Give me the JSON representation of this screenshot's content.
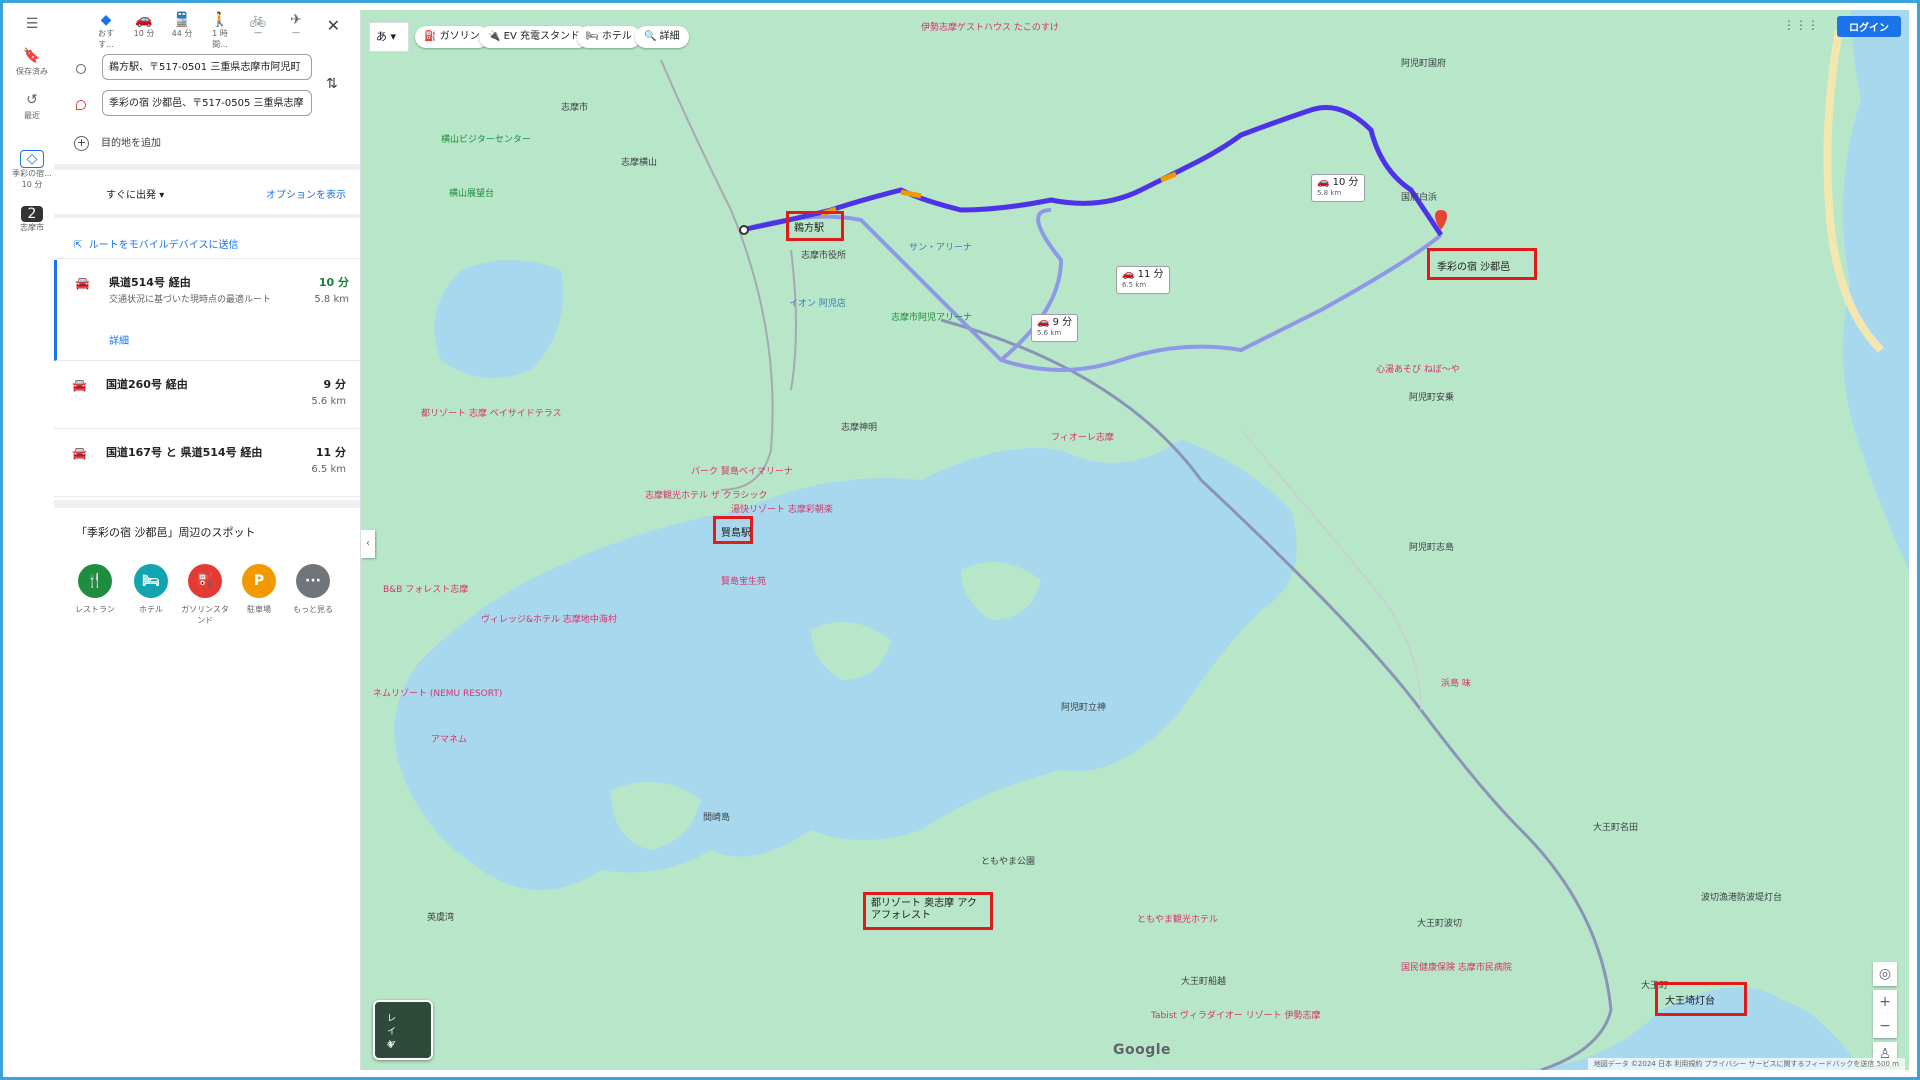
{
  "rail": {
    "saved": "保存済み",
    "recent": "最近",
    "item1": "季彩の宿...",
    "item1_sub": "10 分",
    "item2": "志摩市"
  },
  "modes": [
    {
      "label": "おすす...",
      "icon": "directions-icon"
    },
    {
      "label": "10 分",
      "icon": "car-icon"
    },
    {
      "label": "44 分",
      "icon": "transit-icon"
    },
    {
      "label": "1 時間...",
      "icon": "walk-icon"
    },
    {
      "label": "—",
      "icon": "bicycle-icon"
    },
    {
      "label": "—",
      "icon": "flight-icon"
    }
  ],
  "origin": "鵜方駅、〒517-0501 三重県志摩市阿児町",
  "destination": "季彩の宿 沙都邑、〒517-0505 三重県志摩",
  "add_destination": "目的地を追加",
  "depart": "すぐに出発",
  "options": "オプションを表示",
  "send_to_device": "ルートをモバイルデバイスに送信",
  "routes": [
    {
      "name": "県道514号 経由",
      "time": "10 分",
      "distance": "5.8 km",
      "desc": "交通状況に基づいた現時点の最適ルート",
      "details": "詳細"
    },
    {
      "name": "国道260号 経由",
      "time": "9 分",
      "distance": "5.6 km"
    },
    {
      "name": "国道167号 と 県道514号 経由",
      "time": "11 分",
      "distance": "6.5 km"
    }
  ],
  "nearby_title": "「季彩の宿 沙都邑」周辺のスポット",
  "categories": [
    {
      "label": "レストラン",
      "color": "#1e8e3e",
      "glyph": "🍴"
    },
    {
      "label": "ホテル",
      "color": "#12a4af",
      "glyph": "🛏"
    },
    {
      "label": "ガソリンスタンド",
      "color": "#e53935",
      "glyph": "⛽"
    },
    {
      "label": "駐車場",
      "color": "#f29900",
      "glyph": "P"
    },
    {
      "label": "もっと見る",
      "color": "#70757a",
      "glyph": "···"
    }
  ],
  "map": {
    "ime": "あ",
    "chips": [
      "ガソリン",
      "EV 充電スタンド",
      "ホテル",
      "詳細"
    ],
    "login": "ログイン",
    "layers": "レイヤ",
    "google": "Google",
    "footer": "地図データ ©2024   日本   利用規約   プライバシー   サービスに関するフィードバックを送信   500 m",
    "route_tags": [
      {
        "time": "10 分",
        "dist": "5.8 km"
      },
      {
        "time": "11 分",
        "dist": "6.5 km"
      },
      {
        "time": "9 分",
        "dist": "5.6 km"
      }
    ],
    "highlights": {
      "ugata": "鵜方駅",
      "kashikojima": "賢島駅",
      "satoyu": "季彩の宿 沙都邑",
      "miyako": "都リゾート 奥志摩 アクアフォレスト",
      "daiozaki": "大王埼灯台"
    },
    "labels": {
      "shima_city": "志摩市",
      "yokoyama_vc": "横山ビジターセンター",
      "yokoyama_obs": "横山展望台",
      "shima_yokoyama": "志摩横山",
      "shima_office": "志摩市役所",
      "aeon": "イオン 阿児店",
      "arena": "志摩市阿児アリーナ",
      "sun_arena": "サン・アリーナ",
      "ago_kokufu": "阿児町国府",
      "kokufu_beach": "国府白浜",
      "ago_anori": "阿児町安乗",
      "shinmei": "志摩神明",
      "ago_kou": "阿児町甲賀",
      "ago_shima": "阿児町志島",
      "ise_gh": "伊勢志摩ゲストハウス たこのすけ",
      "ago_nishi": "阿児町鵜方",
      "miyako_bayside": "都リゾート 志摩 ベイサイドテラス",
      "park_bay": "パーク 賢島ベイマリーナ",
      "shima_kanko": "志摩観光ホテル ザ クラシック",
      "yubo": "湯快リゾート 志摩彩朝楽",
      "kashiko_hoseien": "賢島宝生苑",
      "bb_forest": "B&B フォレスト志摩",
      "village": "ヴィレッジ&ホテル 志摩地中海村",
      "nemu": "ネムリゾート (NEMU RESORT)",
      "amanemu": "アマネム",
      "fiore": "フィオーレ志摩",
      "shinko_kou": "心湯あそび ねぼ〜や",
      "ago_anori2": "阿児町甲賀",
      "hamakaze": "浜島 味",
      "ago_hamajima": "阿児町立神",
      "ozaki": "間崎島",
      "eiheiwan": "英虞湾",
      "tomoyama_park": "ともやま公園",
      "tomoyama_hotel": "ともやま観光ホテル",
      "daio_nakiri": "大王町波切",
      "daio_funakoshi": "大王町船越",
      "daio_machi": "大王町名田",
      "national_health": "国民健康保険 志摩市民病院",
      "tabist": "Tabist ヴィラダイオー リゾート 伊勢志摩",
      "nakiri_port": "波切漁港防波堤灯台",
      "daio": "大王町"
    }
  }
}
